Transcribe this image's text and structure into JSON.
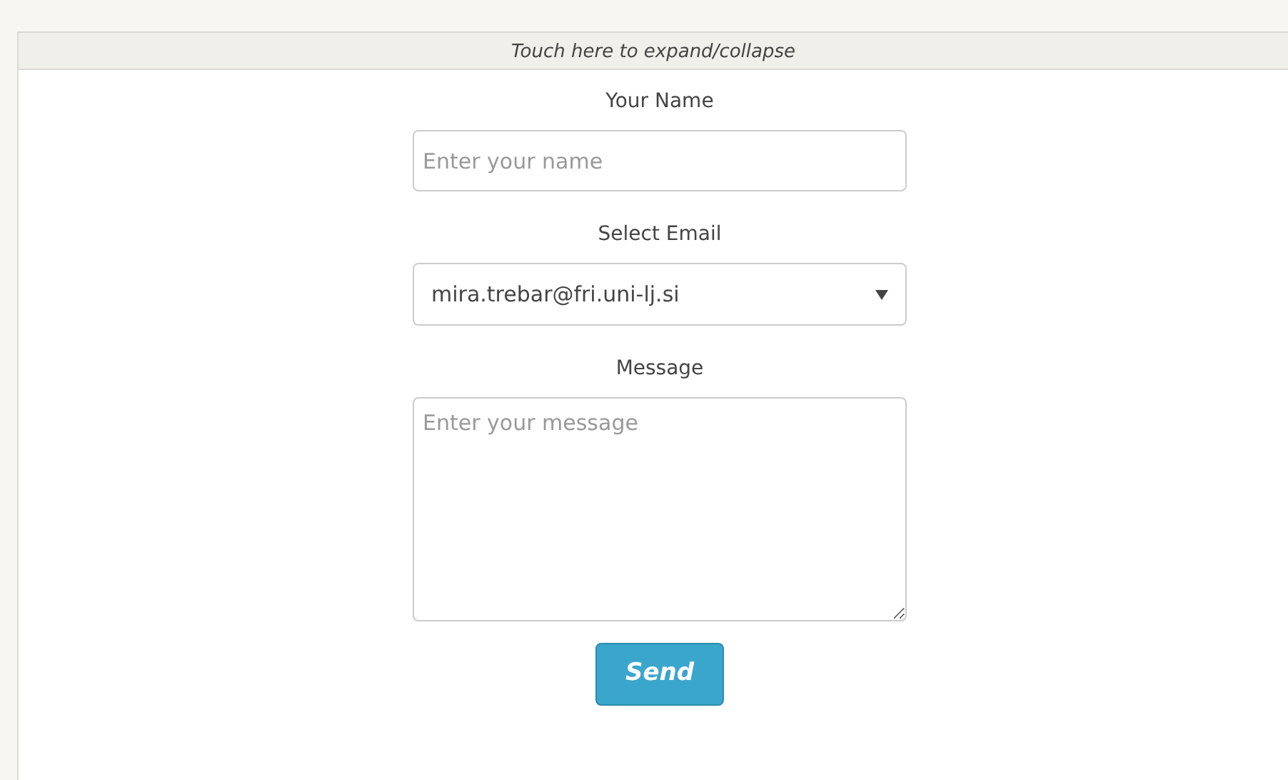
{
  "panel": {
    "header": "Touch here to expand/collapse"
  },
  "form": {
    "fields": [
      {
        "kind": "text",
        "label": "Your Name",
        "placeholder": "Enter your name"
      },
      {
        "kind": "select",
        "label": "Select Email",
        "value": "mira.trebar@fri.uni-lj.si"
      },
      {
        "kind": "textarea",
        "label": "Message",
        "placeholder": "Enter your message"
      }
    ],
    "submit": "Send"
  }
}
